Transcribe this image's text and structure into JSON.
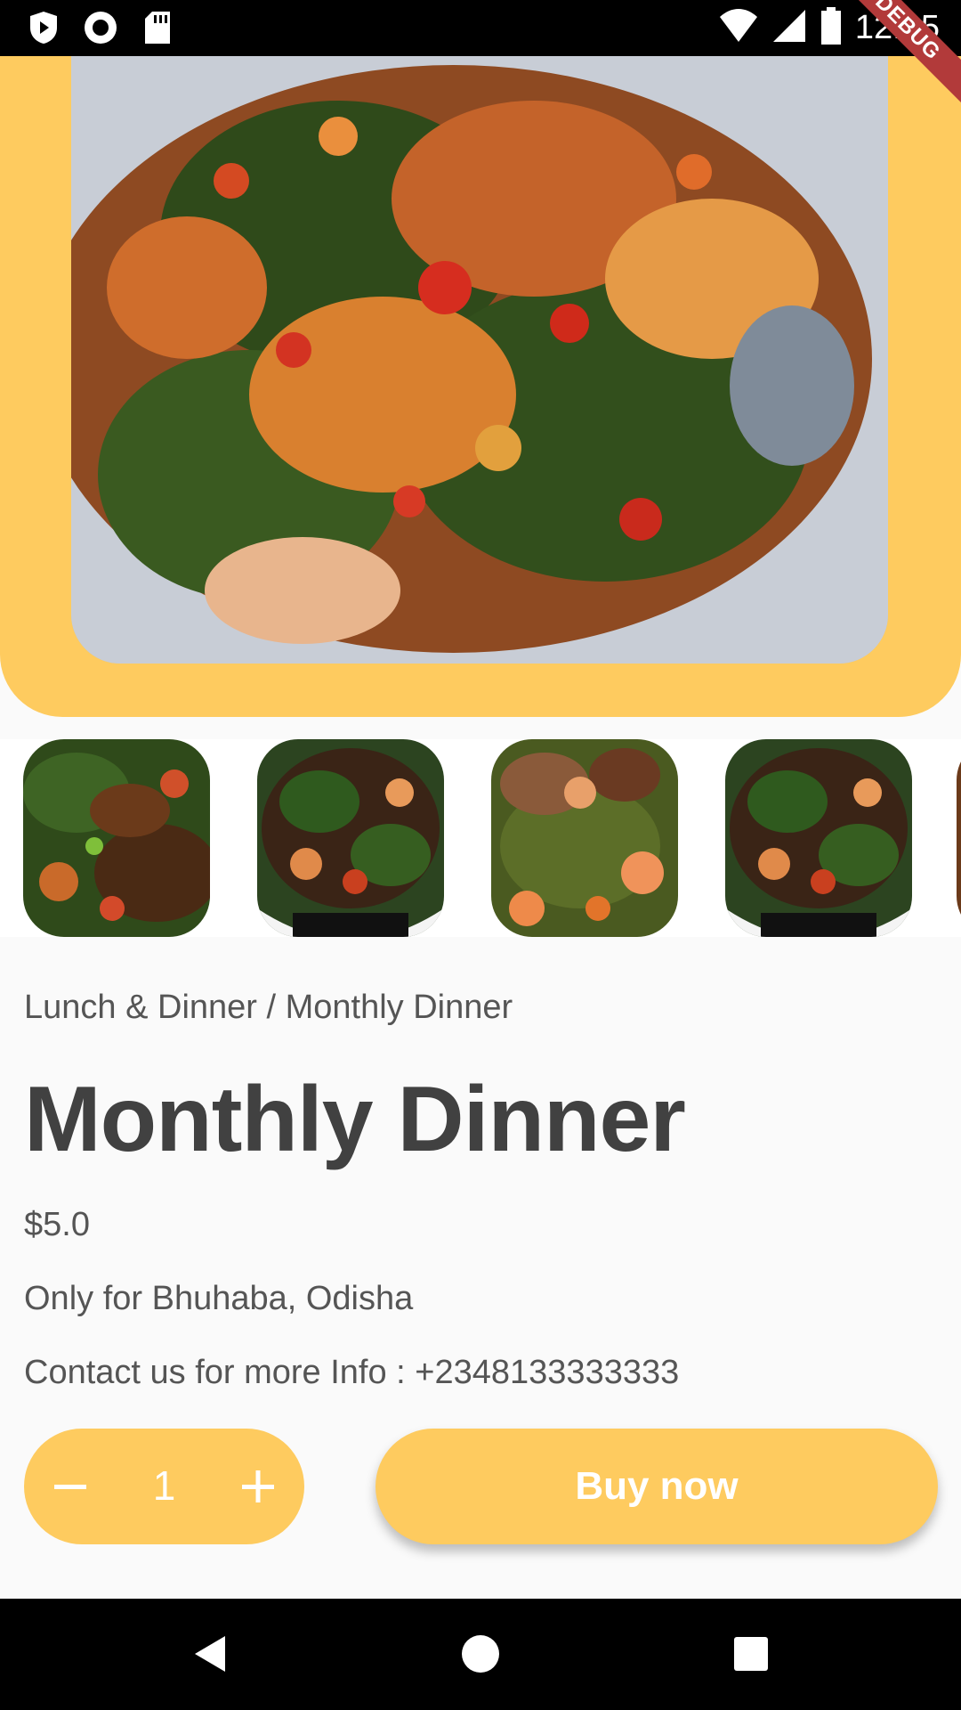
{
  "status_bar": {
    "time": "12:15",
    "left_icons": [
      "play-protect-icon",
      "record-icon",
      "sd-card-icon"
    ],
    "right_icons": [
      "wifi-icon",
      "signal-icon",
      "battery-icon"
    ]
  },
  "debug_label": "DEBUG",
  "hero": {
    "image": "egusi-vegetable-stew-photo"
  },
  "thumbnails": [
    {
      "image": "vegetable-soup-thumbnail-1"
    },
    {
      "image": "vegetable-soup-thumbnail-2"
    },
    {
      "image": "vegetable-soup-thumbnail-3"
    },
    {
      "image": "vegetable-soup-thumbnail-4"
    }
  ],
  "product": {
    "breadcrumb": "Lunch & Dinner / Monthly Dinner",
    "title": "Monthly Dinner",
    "price": "$5.0",
    "location": "Only for Bhuhaba, Odisha",
    "contact": "Contact us for more Info : +2348133333333"
  },
  "quantity": {
    "value": "1"
  },
  "buy_button": {
    "label": "Buy now"
  },
  "colors": {
    "accent": "#fecb5f",
    "text": "#414141",
    "muted": "#555555",
    "background": "#fafafa"
  }
}
